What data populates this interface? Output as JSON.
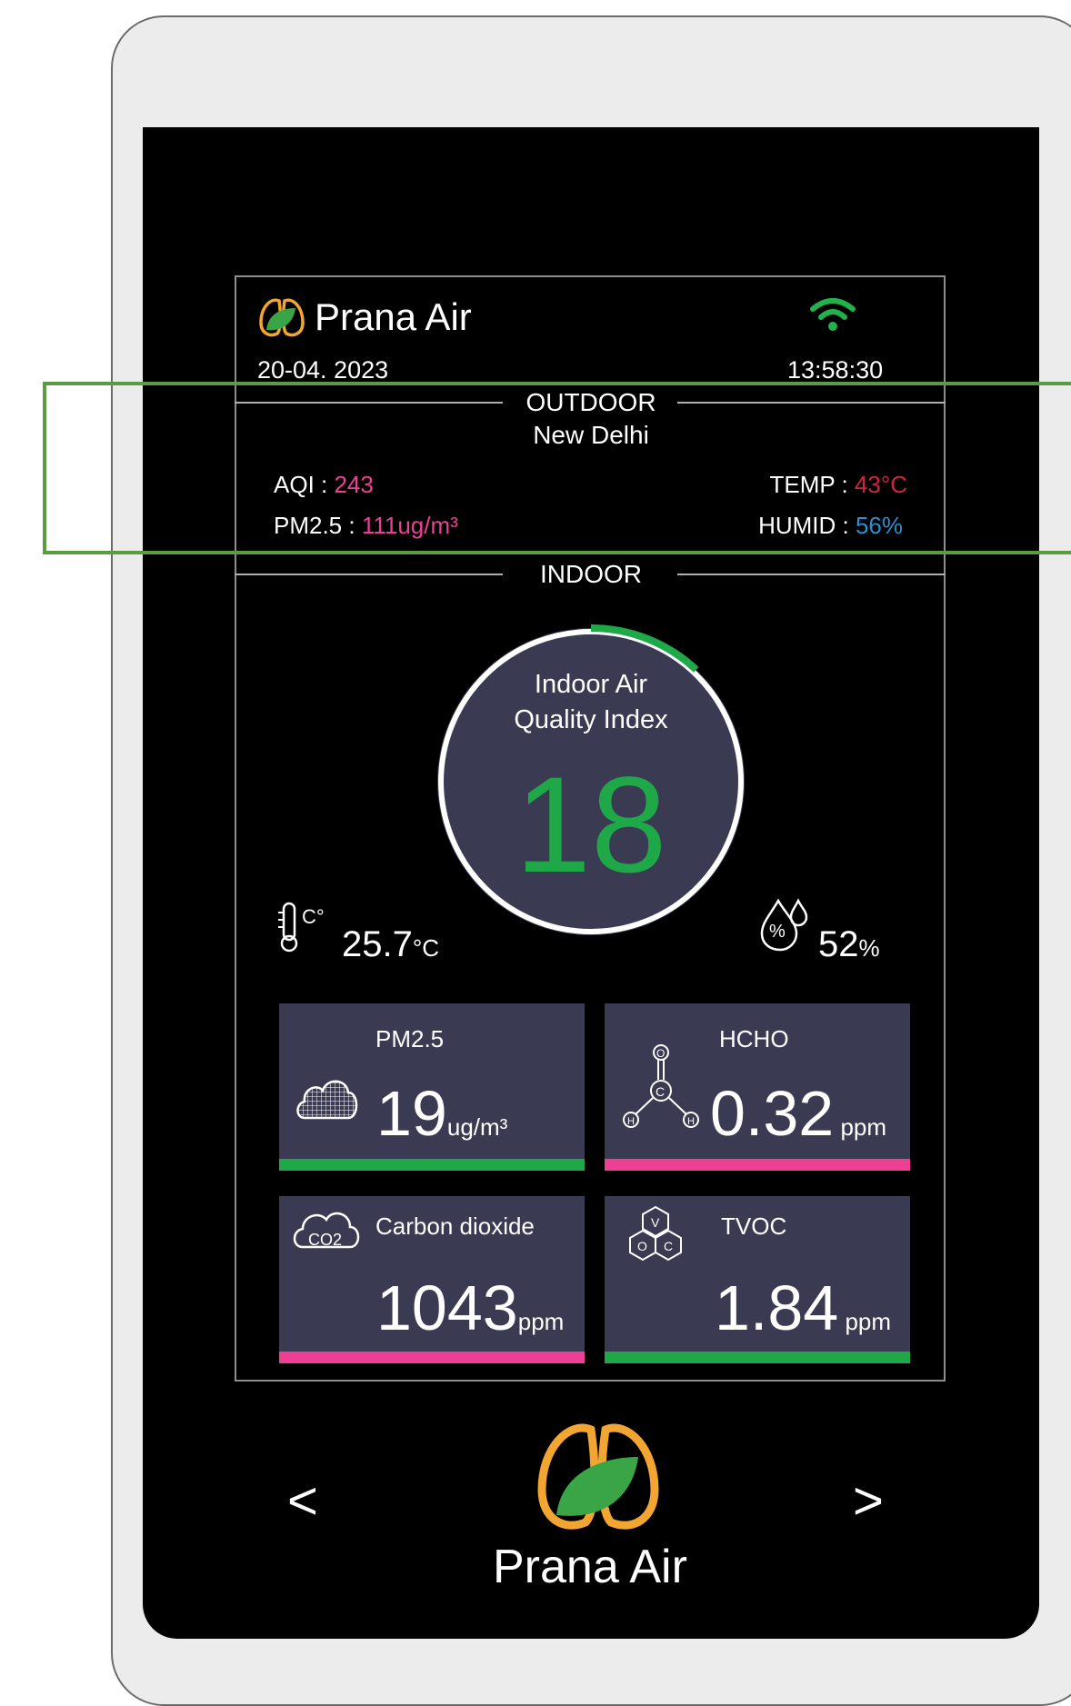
{
  "header": {
    "brand": "Prana Air",
    "date": "20-04. 2023",
    "time": "13:58:30"
  },
  "outdoor": {
    "section_label": "OUTDOOR",
    "city": "New Delhi",
    "aqi_label": "AQI : ",
    "aqi_value": "243",
    "pm25_label": "PM2.5 : ",
    "pm25_value": "111ug/m³",
    "temp_label": "TEMP : ",
    "temp_value": "43°C",
    "humid_label": "HUMID : ",
    "humid_value": "56%"
  },
  "indoor": {
    "section_label": "INDOOR",
    "gauge": {
      "title_line1": "Indoor Air",
      "title_line2": "Quality Index",
      "value": "18",
      "fraction": 0.12
    },
    "temperature": {
      "value": "25.7",
      "unit": "°C"
    },
    "humidity": {
      "value": "52",
      "unit": "%"
    },
    "cards": {
      "pm25": {
        "title": "PM2.5",
        "value": "19",
        "unit": "ug/m³"
      },
      "hcho": {
        "title": "HCHO",
        "value": "0.32",
        "unit": " ppm"
      },
      "co2": {
        "title": "Carbon dioxide",
        "value": "1043",
        "unit": "ppm"
      },
      "tvoc": {
        "title": "TVOC",
        "value": "1.84",
        "unit": " ppm"
      }
    }
  },
  "footer": {
    "prev": "<",
    "next": ">",
    "brand": "Prana Air"
  },
  "colors": {
    "green": "#1ea848",
    "pink": "#ee3f95",
    "red": "#d2243c",
    "blue": "#2b8fd0",
    "card": "#3a3b52"
  },
  "icons": [
    "lungs-leaf-icon",
    "wifi-icon",
    "thermometer-icon",
    "humidity-drop-icon",
    "cloud-dust-icon",
    "formaldehyde-molecule-icon",
    "co2-cloud-icon",
    "voc-molecule-icon"
  ]
}
